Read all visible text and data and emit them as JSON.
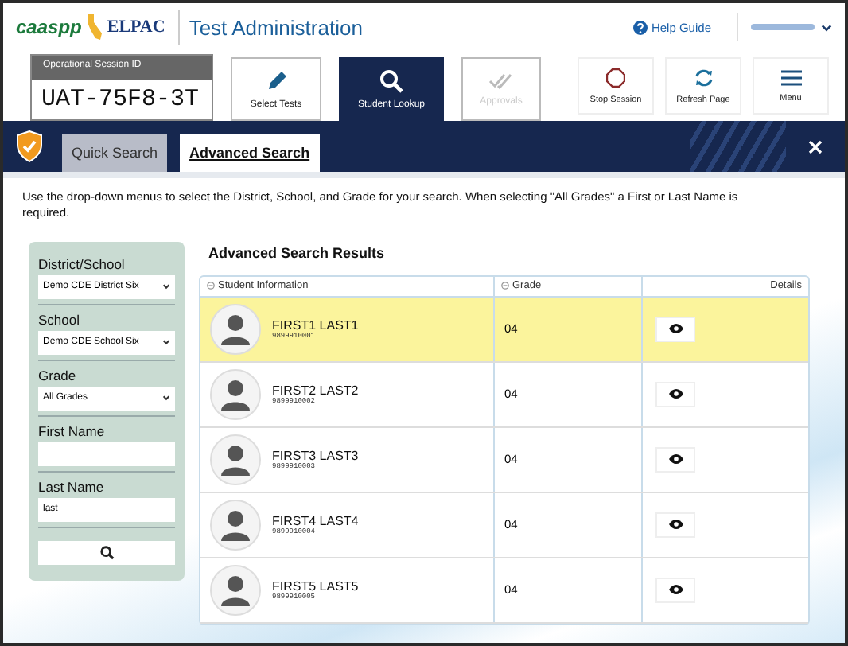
{
  "header": {
    "logos": [
      "caaspp",
      "ELPAC"
    ],
    "title": "Test Administration",
    "help": "Help Guide"
  },
  "session": {
    "label": "Operational Session ID",
    "id": "UAT-75F8-3T"
  },
  "nav": [
    {
      "label": "Select Tests",
      "kind": "pencil",
      "selected": false,
      "disabled": false
    },
    {
      "label": "Student Lookup",
      "kind": "search",
      "selected": true,
      "disabled": false
    },
    {
      "label": "Approvals",
      "kind": "check",
      "selected": false,
      "disabled": true
    }
  ],
  "actions": [
    {
      "label": "Stop Session",
      "kind": "stop"
    },
    {
      "label": "Refresh Page",
      "kind": "refresh"
    },
    {
      "label": "Menu",
      "kind": "menu"
    }
  ],
  "tabs": [
    {
      "label": "Quick Search",
      "selected": false
    },
    {
      "label": "Advanced Search",
      "selected": true
    }
  ],
  "instructions": "Use the drop-down menus to select the District, School, and Grade for your search. When selecting \"All Grades\" a First or Last Name is required.",
  "filters": [
    {
      "label": "District/School",
      "kind": "select",
      "value": "Demo CDE District Six"
    },
    {
      "label": "School",
      "kind": "select",
      "value": "Demo CDE School Six"
    },
    {
      "label": "Grade",
      "kind": "select",
      "value": "All Grades"
    },
    {
      "label": "First Name",
      "kind": "text"
    },
    {
      "label": "Last Name",
      "kind": "text",
      "value": "last"
    }
  ],
  "results": {
    "title": "Advanced Search Results",
    "columns": [
      "Student Information",
      "Grade",
      "Details"
    ],
    "rows": [
      {
        "name": "FIRST1 LAST1",
        "id": "9899910001",
        "grade": "04",
        "selected": true
      },
      {
        "name": "FIRST2 LAST2",
        "id": "9899910002",
        "grade": "04",
        "selected": false
      },
      {
        "name": "FIRST3 LAST3",
        "id": "9899910003",
        "grade": "04",
        "selected": false
      },
      {
        "name": "FIRST4 LAST4",
        "id": "9899910004",
        "grade": "04",
        "selected": false
      },
      {
        "name": "FIRST5 LAST5",
        "id": "9899910005",
        "grade": "04",
        "selected": false
      }
    ]
  }
}
